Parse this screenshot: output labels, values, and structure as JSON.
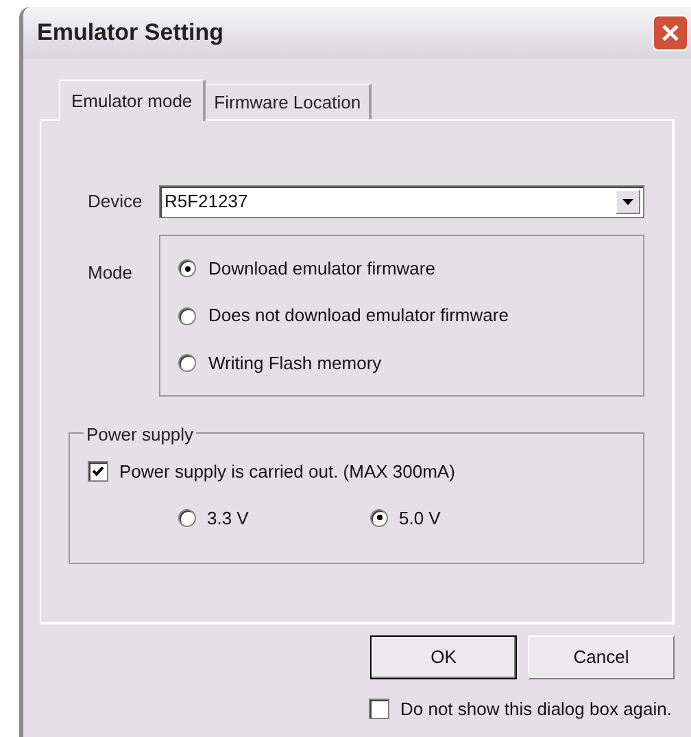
{
  "window": {
    "title": "Emulator Setting"
  },
  "tabs": [
    {
      "label": "Emulator mode",
      "selected": true
    },
    {
      "label": "Firmware Location",
      "selected": false
    }
  ],
  "device": {
    "label": "Device",
    "value": "R5F21237"
  },
  "mode": {
    "label": "Mode",
    "options": [
      {
        "label": "Download emulator firmware",
        "selected": true
      },
      {
        "label": "Does not download emulator firmware",
        "selected": false
      },
      {
        "label": "Writing Flash memory",
        "selected": false
      }
    ]
  },
  "power_supply": {
    "title": "Power supply",
    "checkbox": {
      "label": "Power supply is carried out. (MAX 300mA)",
      "checked": true
    },
    "voltages": [
      {
        "label": "3.3 V",
        "selected": false
      },
      {
        "label": "5.0 V",
        "selected": true
      }
    ]
  },
  "buttons": [
    {
      "label": "OK",
      "default": true
    },
    {
      "label": "Cancel",
      "default": false
    }
  ],
  "dont_show": {
    "label": "Do not show this dialog box again.",
    "checked": false
  }
}
